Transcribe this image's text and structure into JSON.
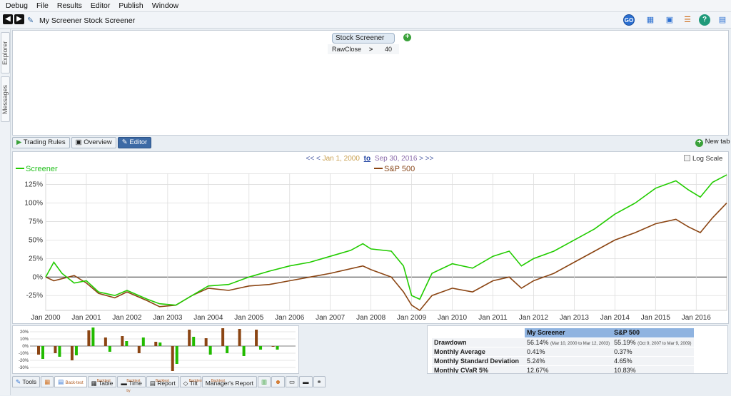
{
  "menu": [
    "Debug",
    "File",
    "Results",
    "Editor",
    "Publish",
    "Window"
  ],
  "document_title": "My Screener Stock Screener",
  "toolbar": {
    "go_label": "GO"
  },
  "side_tabs": [
    "Explorer",
    "Messages"
  ],
  "rules": {
    "tab_label": "Stock Screener",
    "rows": [
      {
        "field": "RawClose",
        "operator": ">",
        "value": "40"
      }
    ]
  },
  "view_tabs": [
    {
      "label": "Trading Rules",
      "active": false
    },
    {
      "label": "Overview",
      "active": false
    },
    {
      "label": "Editor",
      "active": true
    }
  ],
  "new_tab_label": "New tab",
  "range": {
    "prev": "<< <",
    "start": "Jan 1, 2000",
    "to": "to",
    "end": "Sep 30, 2016",
    "next": "> >>"
  },
  "log_scale_label": "Log Scale",
  "chart_data": {
    "type": "line",
    "x_ticks": [
      "Jan 2000",
      "Jan 2001",
      "Jan 2002",
      "Jan 2003",
      "Jan 2004",
      "Jan 2005",
      "Jan 2006",
      "Jan 2007",
      "Jan 2008",
      "Jan 2009",
      "Jan 2010",
      "Jan 2011",
      "Jan 2012",
      "Jan 2013",
      "Jan 2014",
      "Jan 2015",
      "Jan 2016"
    ],
    "y_ticks": [
      "-25%",
      "0%",
      "25%",
      "50%",
      "75%",
      "100%",
      "125%"
    ],
    "ylim": [
      -45,
      140
    ],
    "xlim": [
      2000.0,
      2016.75
    ],
    "series": [
      {
        "name": "Screener",
        "color": "#22cc00",
        "points": [
          [
            2000.0,
            0
          ],
          [
            2000.2,
            20
          ],
          [
            2000.4,
            5
          ],
          [
            2000.7,
            -8
          ],
          [
            2001.0,
            -5
          ],
          [
            2001.3,
            -20
          ],
          [
            2001.7,
            -25
          ],
          [
            2002.0,
            -18
          ],
          [
            2002.5,
            -30
          ],
          [
            2002.8,
            -36
          ],
          [
            2003.2,
            -38
          ],
          [
            2003.6,
            -25
          ],
          [
            2004.0,
            -12
          ],
          [
            2004.5,
            -10
          ],
          [
            2005.0,
            0
          ],
          [
            2005.5,
            8
          ],
          [
            2006.0,
            15
          ],
          [
            2006.5,
            20
          ],
          [
            2007.0,
            28
          ],
          [
            2007.5,
            36
          ],
          [
            2007.8,
            45
          ],
          [
            2008.0,
            38
          ],
          [
            2008.5,
            35
          ],
          [
            2008.8,
            15
          ],
          [
            2009.0,
            -25
          ],
          [
            2009.2,
            -30
          ],
          [
            2009.5,
            5
          ],
          [
            2010.0,
            18
          ],
          [
            2010.5,
            12
          ],
          [
            2011.0,
            28
          ],
          [
            2011.4,
            35
          ],
          [
            2011.7,
            15
          ],
          [
            2012.0,
            25
          ],
          [
            2012.5,
            35
          ],
          [
            2013.0,
            50
          ],
          [
            2013.5,
            65
          ],
          [
            2014.0,
            85
          ],
          [
            2014.5,
            100
          ],
          [
            2015.0,
            120
          ],
          [
            2015.5,
            130
          ],
          [
            2015.8,
            118
          ],
          [
            2016.1,
            108
          ],
          [
            2016.4,
            128
          ],
          [
            2016.75,
            138
          ]
        ]
      },
      {
        "name": "S&P 500",
        "color": "#8b4513",
        "points": [
          [
            2000.0,
            0
          ],
          [
            2000.2,
            -5
          ],
          [
            2000.7,
            2
          ],
          [
            2001.0,
            -8
          ],
          [
            2001.3,
            -22
          ],
          [
            2001.7,
            -28
          ],
          [
            2002.0,
            -20
          ],
          [
            2002.5,
            -32
          ],
          [
            2002.8,
            -40
          ],
          [
            2003.2,
            -38
          ],
          [
            2003.6,
            -25
          ],
          [
            2004.0,
            -15
          ],
          [
            2004.5,
            -18
          ],
          [
            2005.0,
            -12
          ],
          [
            2005.5,
            -10
          ],
          [
            2006.0,
            -5
          ],
          [
            2006.5,
            0
          ],
          [
            2007.0,
            5
          ],
          [
            2007.8,
            15
          ],
          [
            2008.0,
            10
          ],
          [
            2008.5,
            0
          ],
          [
            2008.8,
            -20
          ],
          [
            2009.0,
            -38
          ],
          [
            2009.2,
            -45
          ],
          [
            2009.5,
            -25
          ],
          [
            2010.0,
            -15
          ],
          [
            2010.5,
            -20
          ],
          [
            2011.0,
            -5
          ],
          [
            2011.4,
            0
          ],
          [
            2011.7,
            -15
          ],
          [
            2012.0,
            -5
          ],
          [
            2012.5,
            5
          ],
          [
            2013.0,
            20
          ],
          [
            2013.5,
            35
          ],
          [
            2014.0,
            50
          ],
          [
            2014.5,
            60
          ],
          [
            2015.0,
            72
          ],
          [
            2015.5,
            78
          ],
          [
            2015.8,
            68
          ],
          [
            2016.1,
            60
          ],
          [
            2016.4,
            80
          ],
          [
            2016.75,
            100
          ]
        ]
      }
    ]
  },
  "mini_chart": {
    "y_ticks": [
      "20%",
      "10%",
      "0%",
      "-10%",
      "-20%",
      "-30%"
    ],
    "ylim": [
      -35,
      25
    ],
    "bars": [
      [
        -12,
        -18
      ],
      [
        -10,
        -15
      ],
      [
        -20,
        -13
      ],
      [
        22,
        26
      ],
      [
        12,
        -8
      ],
      [
        14,
        7
      ],
      [
        -10,
        12
      ],
      [
        6,
        5
      ],
      [
        -35,
        -25
      ],
      [
        23,
        13
      ],
      [
        11,
        -12
      ],
      [
        25,
        -10
      ],
      [
        24,
        -14
      ],
      [
        23,
        -5
      ],
      [
        -1,
        -5
      ]
    ]
  },
  "stats": {
    "headers": [
      "",
      "My Screener",
      "S&P 500"
    ],
    "rows": [
      {
        "label": "Drawdown",
        "v1": "56.14%",
        "n1": "(Mar 10, 2000 to Mar 12, 2003)",
        "v2": "55.19%",
        "n2": "(Oct 9, 2007 to Mar 9, 2009)"
      },
      {
        "label": "Monthly Average",
        "v1": "0.41%",
        "n1": "",
        "v2": "0.37%",
        "n2": ""
      },
      {
        "label": "Monthly Standard Deviation",
        "v1": "5.24%",
        "n1": "",
        "v2": "4.65%",
        "n2": ""
      },
      {
        "label": "Monthly CVaR 5%",
        "v1": "12.67%",
        "n1": "",
        "v2": "10.83%",
        "n2": ""
      }
    ]
  },
  "bottom_tabs": [
    {
      "sup": "",
      "label": "Tools"
    },
    {
      "sup": "",
      "label": ""
    },
    {
      "sup": "",
      "label": "Back-test"
    },
    {
      "sup": "Backtest",
      "label": "Table"
    },
    {
      "sup": "Backtest by",
      "label": "Time"
    },
    {
      "sup": "Backtest",
      "label": "Report"
    },
    {
      "sup": "Backtest",
      "label": "Tilt"
    },
    {
      "sup": "Backtest",
      "label": "Manager's Report"
    }
  ]
}
